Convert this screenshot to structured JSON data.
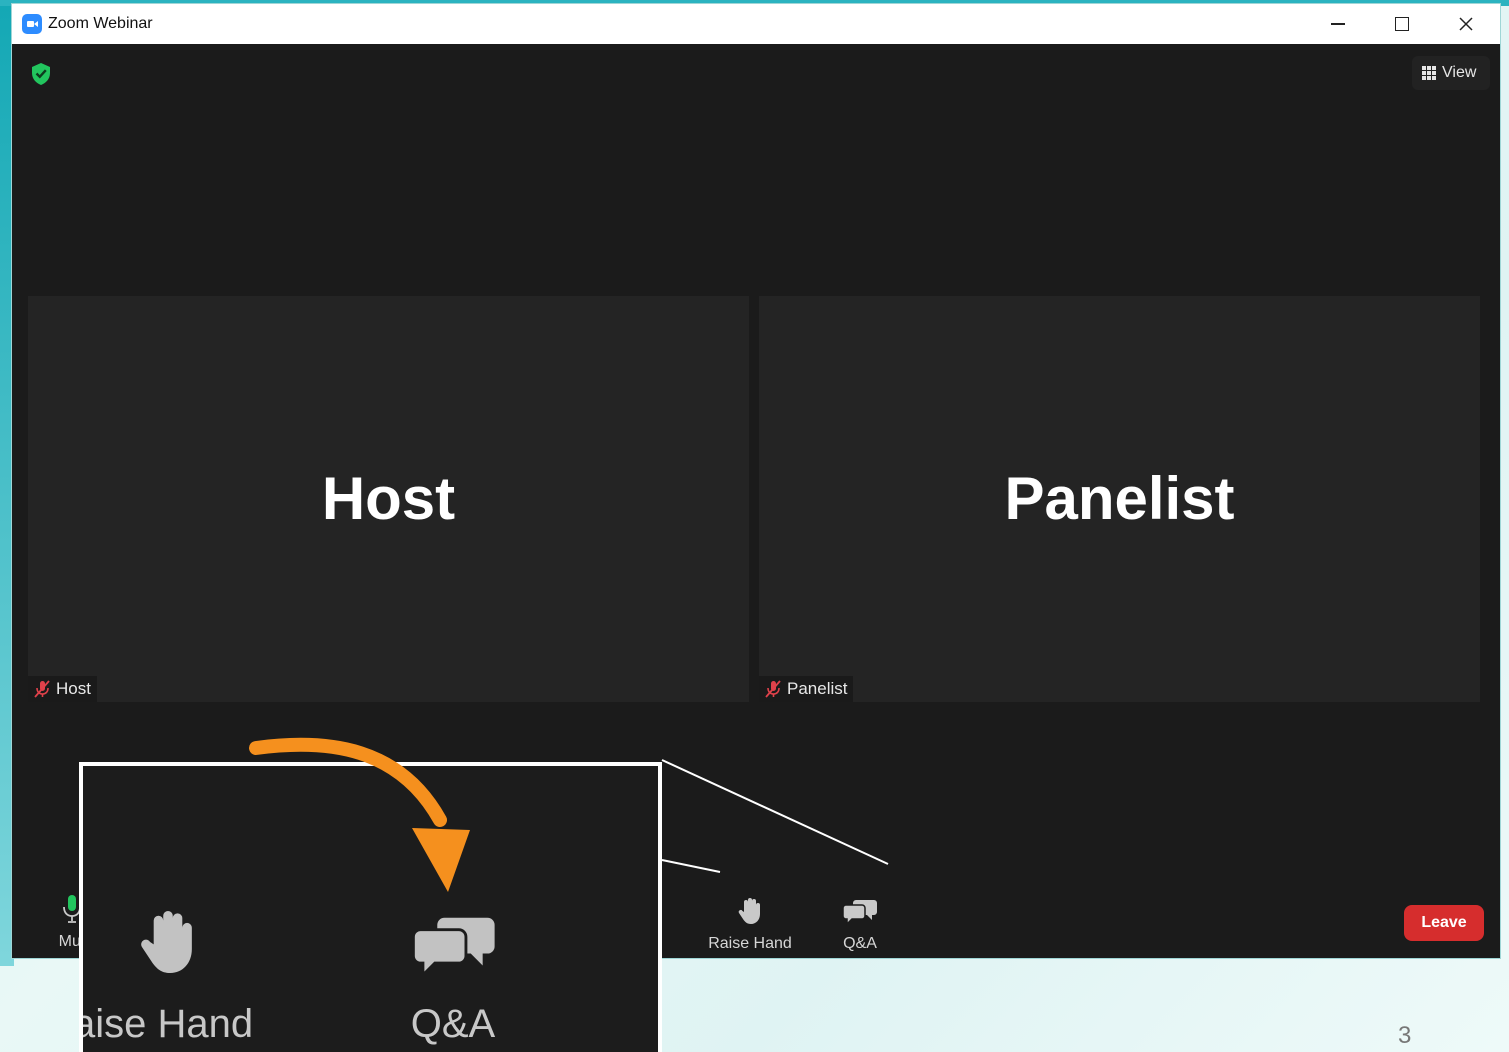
{
  "window": {
    "title": "Zoom Webinar"
  },
  "header": {
    "view_label": "View"
  },
  "tiles": [
    {
      "name": "Host",
      "tag": "Host"
    },
    {
      "name": "Panelist",
      "tag": "Panelist"
    }
  ],
  "toolbar": {
    "mute_label": "Mut",
    "raise_hand_label": "Raise Hand",
    "qa_label": "Q&A",
    "leave_label": "Leave"
  },
  "callout": {
    "raise_hand_label": "aise Hand",
    "qa_label": "Q&A"
  },
  "slide": {
    "number": "3"
  },
  "colors": {
    "leave": "#d62d2d",
    "shield": "#22c55e",
    "arrow": "#f5901e",
    "mic": "#22c55e"
  }
}
